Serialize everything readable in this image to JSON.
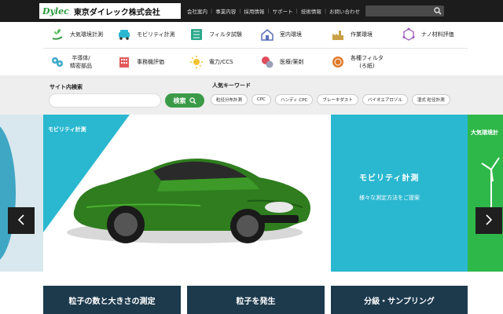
{
  "brand": {
    "mark": "Dylec",
    "name": "東京ダイレック株式会社"
  },
  "topnav": [
    "会社案内",
    "事業内容",
    "採用情報",
    "サポート",
    "技術情報",
    "お問い合わせ"
  ],
  "categories": [
    {
      "label": "大気環境計測",
      "icon": "plant-icon"
    },
    {
      "label": "モビリティ計測",
      "icon": "car-icon"
    },
    {
      "label": "フィルタ試験",
      "icon": "filter-icon"
    },
    {
      "label": "室内環境",
      "icon": "house-icon"
    },
    {
      "label": "作業環境",
      "icon": "factory-icon"
    },
    {
      "label": "ナノ材料評価",
      "icon": "molecule-icon"
    },
    {
      "label": "半導体/\n精密部品",
      "icon": "semiconductor-icon"
    },
    {
      "label": "事務機評価",
      "icon": "office-icon"
    },
    {
      "label": "電力/CCS",
      "icon": "power-icon"
    },
    {
      "label": "医療/薬剤",
      "icon": "medical-icon"
    },
    {
      "label": "各種フィルタ\n(ろ紙)",
      "icon": "filter-paper-icon"
    }
  ],
  "search": {
    "label": "サイト内検索",
    "button": "検索"
  },
  "keywords": {
    "label": "人気キーワード",
    "items": [
      "粒径分布計測",
      "CPC",
      "ハンディ CPC",
      "ブレーキダスト",
      "バイオエアロゾル",
      "湿式 粒径計測"
    ]
  },
  "hero": {
    "slide_tag": "モビリティ計測",
    "panel_title": "モビリティ計測",
    "panel_sub": "様々な測定方法をご提案",
    "next_tag": "大気環境計"
  },
  "buttons": [
    "粒子の数と大きさの測定",
    "粒子を発生",
    "分級・サンプリング"
  ],
  "colors": {
    "accent": "#2ab8d0",
    "green": "#3a9a48",
    "dark": "#1c1c1c",
    "navy": "#1d3a4d",
    "car": "#2f7d1e"
  }
}
